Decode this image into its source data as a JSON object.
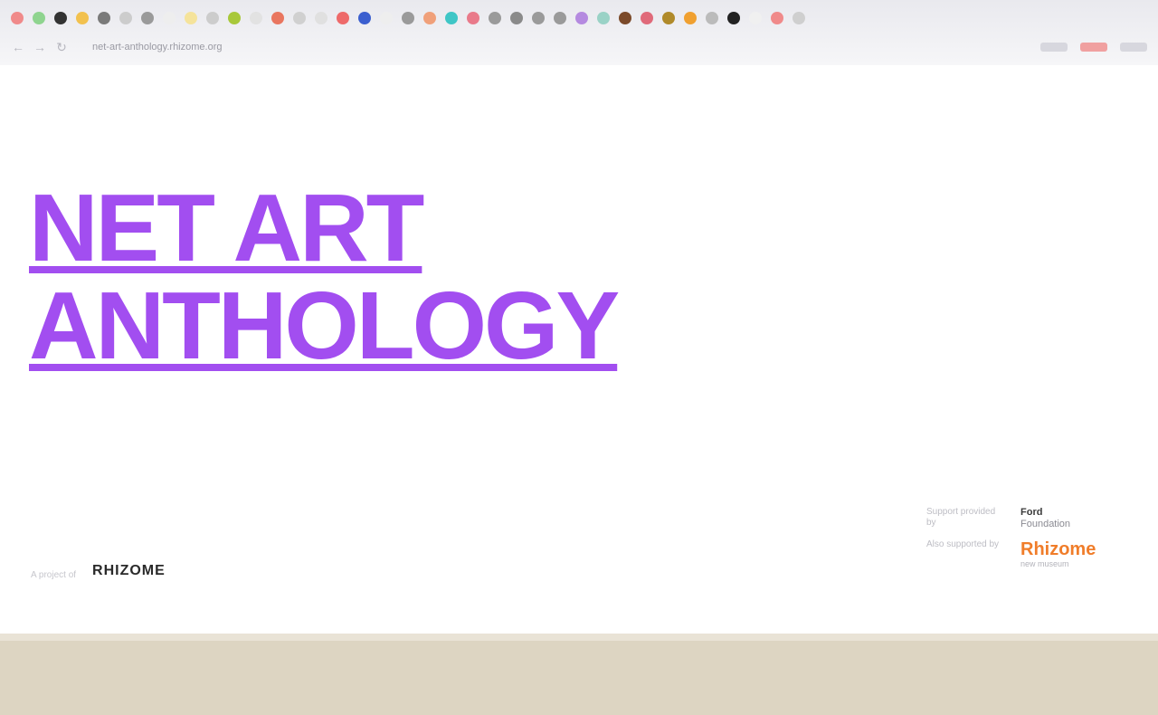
{
  "browser": {
    "tab_favicon_colors": [
      "#f08a8a",
      "#8fd48f",
      "#333333",
      "#f2c14e",
      "#7a7a7a",
      "#cccccc",
      "#9a9a9a",
      "#eeeeee",
      "#f5e39b",
      "#cccccc",
      "#a8c83a",
      "#e2e2e2",
      "#e9765f",
      "#d0d0d0",
      "#e0e0e0",
      "#ee6a6a",
      "#3b5fcf",
      "#eeeeee",
      "#9a9a9a",
      "#f0a07a",
      "#3fc6c6",
      "#e97a8a",
      "#9a9a9a",
      "#8a8a8a",
      "#9a9a9a",
      "#9a9a9a",
      "#b58ae0",
      "#9ad2c6",
      "#7b4a2a",
      "#e06a7a",
      "#b08a2a",
      "#f0a030",
      "#bbbbbb",
      "#222222",
      "#f0f0f0",
      "#f08a8a",
      "#cfcfcf"
    ],
    "url": "net-art-anthology.rhizome.org",
    "icons": {
      "back": "back-arrow-icon",
      "forward": "forward-arrow-icon",
      "reload": "reload-icon"
    }
  },
  "hero": {
    "title_line1": "NET ART",
    "title_line2": "ANTHOLOGY",
    "color": "#a24ef0"
  },
  "footer_left": {
    "caption": "A project of",
    "logo_text": "RHIZOME"
  },
  "credits": {
    "row1_label": "Support provided by",
    "row1_value": "Ford",
    "row1_sub": "Foundation",
    "row2_label": "Also supported by",
    "partner_logo": "Rhizome",
    "partner_caption": "new museum"
  },
  "colors": {
    "accent": "#a24ef0",
    "band": "#ddd5c2",
    "partner": "#f07d2a"
  }
}
